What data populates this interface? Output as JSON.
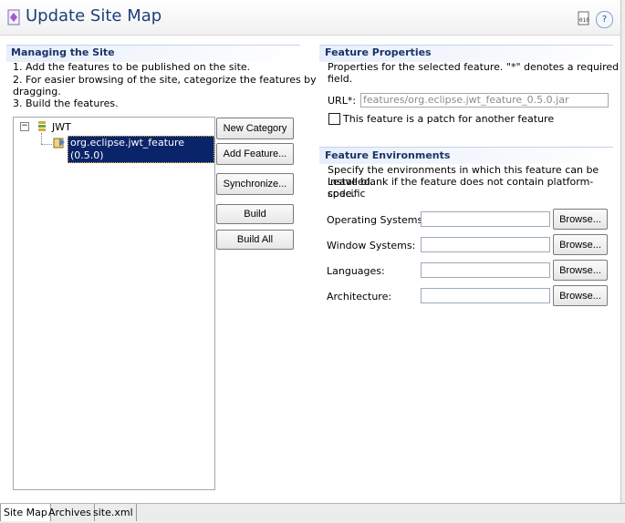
{
  "header": {
    "title": "Update Site Map",
    "icons": [
      "binary-icon",
      "help-icon"
    ]
  },
  "managing": {
    "title": "Managing the Site",
    "steps": [
      "1. Add the features to be published on the site.",
      "2. For easier browsing of the site, categorize the features by",
      "dragging.",
      "3. Build the features."
    ],
    "tree": {
      "category": "JWT",
      "feature": "org.eclipse.jwt_feature (0.5.0)"
    },
    "buttons": {
      "new_category": "New Category",
      "add_feature": "Add Feature...",
      "synchronize": "Synchronize...",
      "build": "Build",
      "build_all": "Build All"
    }
  },
  "feature_properties": {
    "title": "Feature Properties",
    "desc1": "Properties for the selected feature.  \"*\" denotes a required",
    "desc2": "field.",
    "url_label": "URL*:",
    "url_value": "features/org.eclipse.jwt_feature_0.5.0.jar",
    "patch_label": "This feature is a patch for another feature"
  },
  "feature_env": {
    "title": "Feature Environments",
    "desc1": "Specify the environments in which this feature can be installed.",
    "desc2": "Leave blank if the feature does not contain platform-specific",
    "desc3": "code.",
    "rows": [
      {
        "label": "Operating Systems:",
        "value": "",
        "button": "Browse..."
      },
      {
        "label": "Window Systems:",
        "value": "",
        "button": "Browse..."
      },
      {
        "label": "Languages:",
        "value": "",
        "button": "Browse..."
      },
      {
        "label": "Architecture:",
        "value": "",
        "button": "Browse..."
      }
    ]
  },
  "tabs": [
    "Site Map",
    "Archives",
    "site.xml"
  ]
}
